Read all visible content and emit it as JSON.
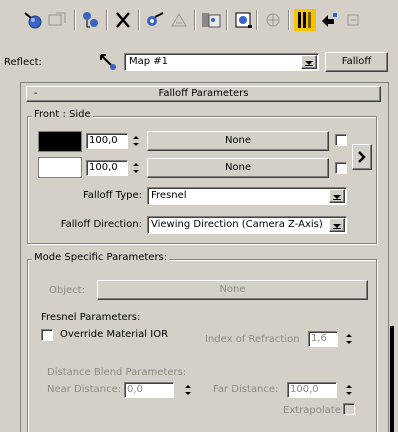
{
  "toolbar": {
    "icons": [
      "pick-material-icon",
      "put-to-scene-icon",
      "assign-material-icon",
      "delete-icon",
      "make-unique-icon",
      "put-to-library-icon",
      "material-effects-channel-icon",
      "show-map-icon",
      "show-end-result-icon",
      "go-to-parent-icon",
      "go-forward-icon"
    ]
  },
  "reflect": {
    "label": "Reflect:",
    "map_name": "Map #1",
    "type_button": "Falloff"
  },
  "rollout": {
    "collapse_sign": "-",
    "title": "Falloff Parameters"
  },
  "front_side": {
    "legend": "Front : Side",
    "color1": "#000000",
    "amount1": "100,0",
    "map1": "None",
    "color2": "#ffffff",
    "amount2": "100,0",
    "map2": "None",
    "falloff_type_label": "Falloff Type:",
    "falloff_type_value": "Fresnel",
    "falloff_direction_label": "Falloff Direction:",
    "falloff_direction_value": "Viewing Direction (Camera Z-Axis)"
  },
  "mode_specific": {
    "legend": "Mode Specific Parameters:",
    "object_label": "Object:",
    "object_value": "None",
    "fresnel_heading": "Fresnel Parameters:",
    "override_label": "Override Material IOR",
    "ior_label": "Index of Refraction",
    "ior_value": "1,6",
    "distance_heading": "Distance Blend Parameters:",
    "near_label": "Near Distance:",
    "near_value": "0,0",
    "far_label": "Far Distance:",
    "far_value": "100,0",
    "extrapolate_label": "Extrapolate"
  }
}
